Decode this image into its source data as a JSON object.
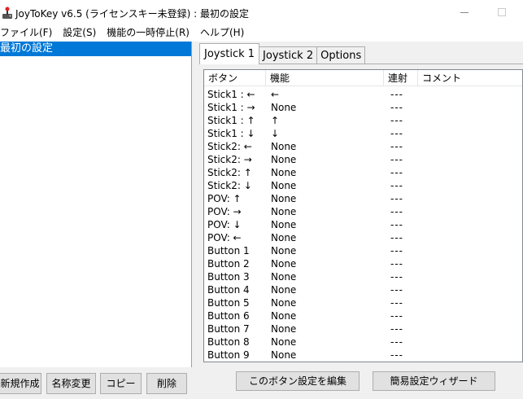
{
  "window": {
    "title": "JoyToKey v6.5 (ライセンスキー未登録) : 最初の設定"
  },
  "menu": [
    {
      "label": "ファイル(F)"
    },
    {
      "label": "設定(S)"
    },
    {
      "label": "機能の一時停止(R)"
    },
    {
      "label": "ヘルプ(H)"
    }
  ],
  "config_list": {
    "items": [
      {
        "label": "最初の設定",
        "selected": true
      }
    ]
  },
  "left_buttons": {
    "new": "新規作成",
    "rename": "名称変更",
    "copy": "コピー",
    "delete": "削除"
  },
  "tabs": [
    {
      "label": "Joystick 1",
      "active": true
    },
    {
      "label": "Joystick 2",
      "active": false
    },
    {
      "label": "Options",
      "active": false
    }
  ],
  "table": {
    "columns": [
      "ボタン",
      "機能",
      "連射",
      "コメント"
    ],
    "rows": [
      {
        "button": "Stick1 : ←",
        "function": "←",
        "turbo": "---"
      },
      {
        "button": "Stick1 : →",
        "function": "None",
        "turbo": "---"
      },
      {
        "button": "Stick1 : ↑",
        "function": "↑",
        "turbo": "---"
      },
      {
        "button": "Stick1 : ↓",
        "function": "↓",
        "turbo": "---"
      },
      {
        "button": "Stick2: ←",
        "function": "None",
        "turbo": "---"
      },
      {
        "button": "Stick2: →",
        "function": "None",
        "turbo": "---"
      },
      {
        "button": "Stick2: ↑",
        "function": "None",
        "turbo": "---"
      },
      {
        "button": "Stick2: ↓",
        "function": "None",
        "turbo": "---"
      },
      {
        "button": "POV: ↑",
        "function": "None",
        "turbo": "---"
      },
      {
        "button": "POV: →",
        "function": "None",
        "turbo": "---"
      },
      {
        "button": "POV: ↓",
        "function": "None",
        "turbo": "---"
      },
      {
        "button": "POV: ←",
        "function": "None",
        "turbo": "---"
      },
      {
        "button": "Button 1",
        "function": "None",
        "turbo": "---"
      },
      {
        "button": "Button 2",
        "function": "None",
        "turbo": "---"
      },
      {
        "button": "Button 3",
        "function": "None",
        "turbo": "---"
      },
      {
        "button": "Button 4",
        "function": "None",
        "turbo": "---"
      },
      {
        "button": "Button 5",
        "function": "None",
        "turbo": "---"
      },
      {
        "button": "Button 6",
        "function": "None",
        "turbo": "---"
      },
      {
        "button": "Button 7",
        "function": "None",
        "turbo": "---"
      },
      {
        "button": "Button 8",
        "function": "None",
        "turbo": "---"
      },
      {
        "button": "Button 9",
        "function": "None",
        "turbo": "---"
      }
    ]
  },
  "right_buttons": {
    "edit": "このボタン設定を編集",
    "wizard": "簡易設定ウィザード"
  },
  "colors": {
    "selection": "#0078d7",
    "button_face": "#e1e1e1",
    "panel_bg": "#f0f0f0"
  },
  "icons": {
    "app": "joystick-icon",
    "minimize": "minimize-icon",
    "maximize": "maximize-icon"
  }
}
